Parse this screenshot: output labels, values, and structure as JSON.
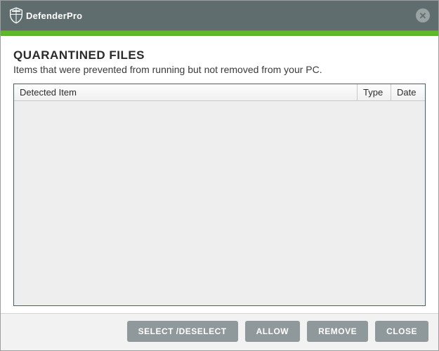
{
  "app": {
    "name": "DefenderPro"
  },
  "page": {
    "title": "QUARANTINED FILES",
    "subtitle": "Items that were prevented from running but not removed from your PC."
  },
  "table": {
    "columns": {
      "detected": "Detected Item",
      "type": "Type",
      "date": "Date"
    },
    "rows": []
  },
  "footer": {
    "select_deselect": "SELECT /DESELECT",
    "allow": "ALLOW",
    "remove": "REMOVE",
    "close": "CLOSE"
  }
}
